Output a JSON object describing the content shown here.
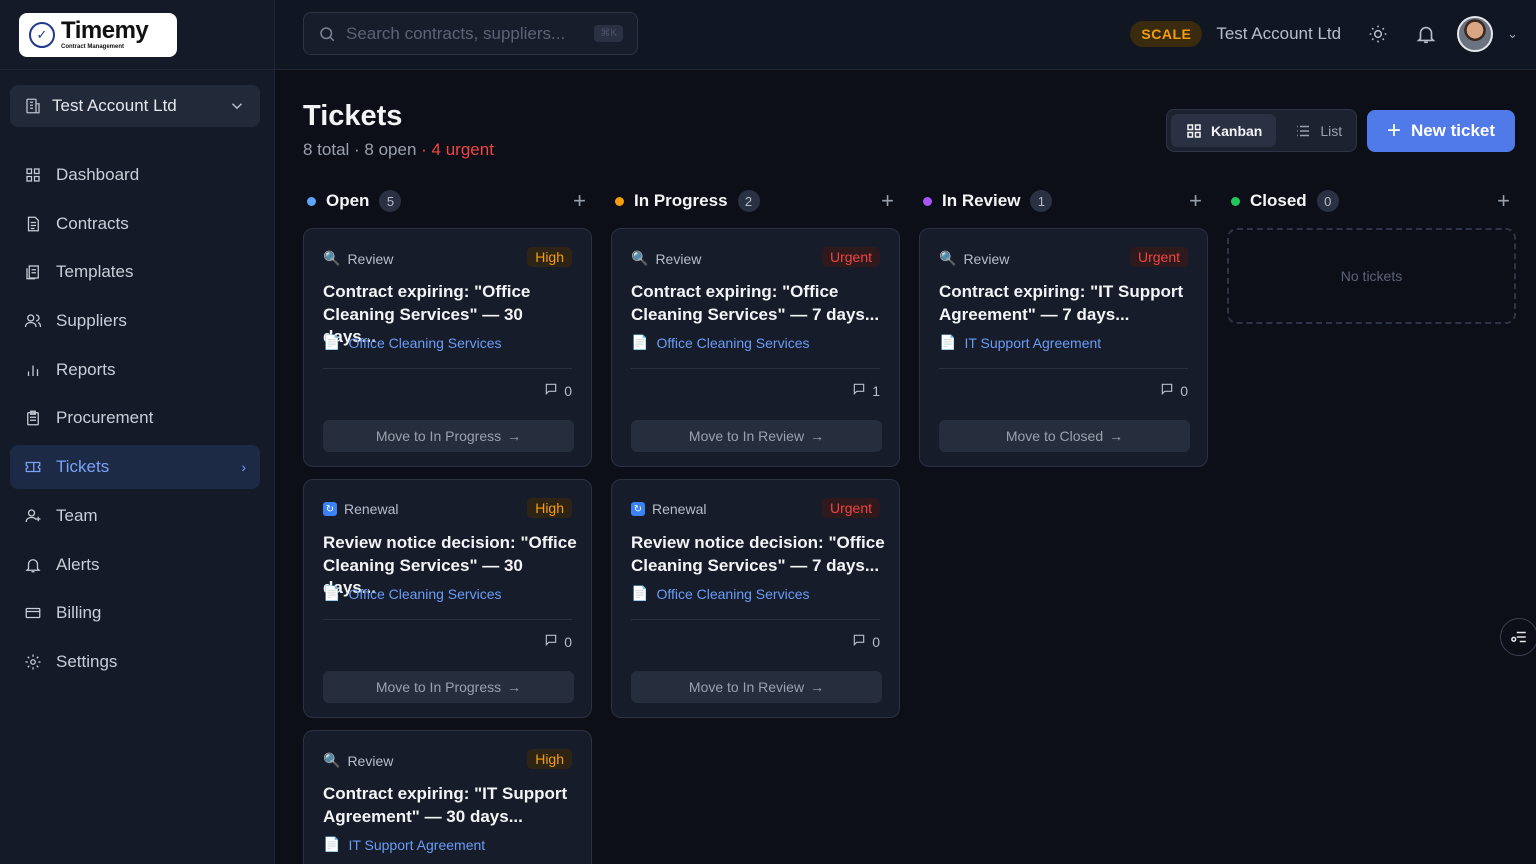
{
  "app": {
    "name": "Timemy",
    "subtitle": "Contract Management"
  },
  "sidebar": {
    "account": "Test Account Ltd",
    "items": [
      {
        "label": "Dashboard",
        "icon": "grid-icon"
      },
      {
        "label": "Contracts",
        "icon": "file-icon"
      },
      {
        "label": "Templates",
        "icon": "copy-icon"
      },
      {
        "label": "Suppliers",
        "icon": "users-icon"
      },
      {
        "label": "Reports",
        "icon": "bar-chart-icon"
      },
      {
        "label": "Procurement",
        "icon": "clipboard-icon"
      },
      {
        "label": "Tickets",
        "icon": "ticket-icon",
        "active": true
      },
      {
        "label": "Team",
        "icon": "user-plus-icon"
      },
      {
        "label": "Alerts",
        "icon": "bell-icon"
      },
      {
        "label": "Billing",
        "icon": "credit-card-icon"
      },
      {
        "label": "Settings",
        "icon": "gear-icon"
      }
    ]
  },
  "topbar": {
    "search_placeholder": "Search contracts, suppliers...",
    "search_shortcut": "⌘K",
    "plan": "SCALE",
    "account": "Test Account Ltd"
  },
  "header": {
    "title": "Tickets",
    "summary": "8 total · 8 open",
    "urgent": "· 4 urgent",
    "view_kanban": "Kanban",
    "view_list": "List",
    "new_ticket": "New ticket"
  },
  "columns": [
    {
      "name": "Open",
      "count": "5",
      "color": "#60a5fa",
      "cards": [
        {
          "type": "Review",
          "priority": "High",
          "title_1": "Contract expiring: \"Office",
          "title_2": "Cleaning Services\" — 30 days...",
          "link": "Office Cleaning Services",
          "comments": "0",
          "move": "Move to In Progress"
        },
        {
          "type": "Renewal",
          "priority": "High",
          "title_1": "Review notice decision: \"Office",
          "title_2": "Cleaning Services\" — 30 days...",
          "link": "Office Cleaning Services",
          "comments": "0",
          "move": "Move to In Progress"
        },
        {
          "type": "Review",
          "priority": "High",
          "title_1": "Contract expiring: \"IT Support",
          "title_2": "Agreement\" — 30 days...",
          "link": "IT Support Agreement",
          "comments": "",
          "move": ""
        }
      ]
    },
    {
      "name": "In Progress",
      "count": "2",
      "color": "#f59e0b",
      "cards": [
        {
          "type": "Review",
          "priority": "Urgent",
          "title_1": "Contract expiring: \"Office",
          "title_2": "Cleaning Services\" — 7 days...",
          "link": "Office Cleaning Services",
          "comments": "1",
          "move": "Move to In Review"
        },
        {
          "type": "Renewal",
          "priority": "Urgent",
          "title_1": "Review notice decision: \"Office",
          "title_2": "Cleaning Services\" — 7 days...",
          "link": "Office Cleaning Services",
          "comments": "0",
          "move": "Move to In Review"
        }
      ]
    },
    {
      "name": "In Review",
      "count": "1",
      "color": "#a855f7",
      "cards": [
        {
          "type": "Review",
          "priority": "Urgent",
          "title_1": "Contract expiring: \"IT Support",
          "title_2": "Agreement\" — 7 days...",
          "link": "IT Support Agreement",
          "comments": "0",
          "move": "Move to Closed"
        }
      ]
    },
    {
      "name": "Closed",
      "count": "0",
      "color": "#22c55e",
      "empty": "No tickets",
      "cards": []
    }
  ]
}
